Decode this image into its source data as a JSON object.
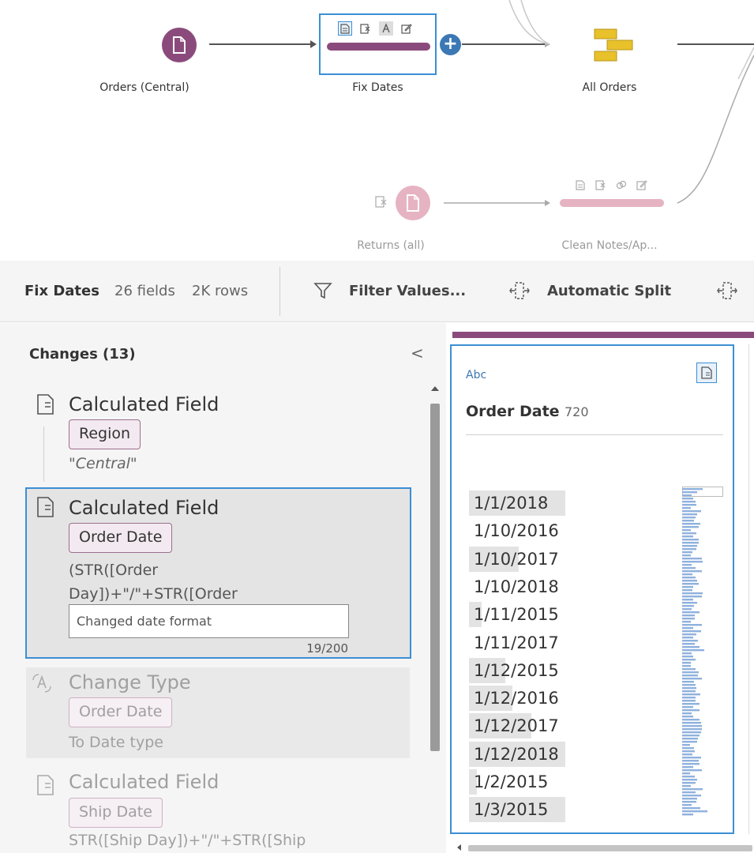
{
  "flow": {
    "nodes": [
      {
        "label": "Orders (Central)"
      },
      {
        "label": "Fix Dates"
      },
      {
        "label": "All Orders"
      },
      {
        "label": "Returns (all)"
      },
      {
        "label": "Clean Notes/Ap..."
      }
    ],
    "add_button": "+"
  },
  "toolbar": {
    "step_name": "Fix Dates",
    "fields": "26 fields",
    "rows": "2K rows",
    "filter_label": "Filter Values...",
    "split_label": "Automatic Split"
  },
  "changes": {
    "header": "Changes (13)",
    "collapse": "<",
    "items": [
      {
        "title": "Calculated Field",
        "field": "Region",
        "detail": "\"Central\""
      },
      {
        "title": "Calculated Field",
        "field": "Order Date",
        "formula_line1": "(STR([Order",
        "formula_line2": "Day])+\"/\"+STR([Order",
        "note_value": "Changed date format",
        "char_count": "19/200"
      },
      {
        "title": "Change Type",
        "field": "Order Date",
        "detail": "To Date type"
      },
      {
        "title": "Calculated Field",
        "field": "Ship Date",
        "formula_line1": "STR([Ship Day])+\"/\"+STR([Ship"
      }
    ]
  },
  "profile": {
    "type_label": "Abc",
    "field_name": "Order Date",
    "count": "720",
    "values": [
      "1/1/2018",
      "1/10/2016",
      "1/10/2017",
      "1/10/2018",
      "1/11/2015",
      "1/11/2017",
      "1/12/2015",
      "1/12/2016",
      "1/12/2017",
      "1/12/2018",
      "1/2/2015",
      "1/3/2015"
    ],
    "value_fill": [
      1.0,
      0.0,
      0.52,
      0.0,
      0.13,
      0.0,
      0.38,
      0.45,
      0.65,
      1.0,
      0.08,
      1.0
    ]
  },
  "colors": {
    "accent_blue": "#3b8fd4",
    "input_node": "#8a4b7c",
    "union_node": "#e8c12b",
    "faded_node": "#e6b3c2",
    "pill_border": "#9c6f8e",
    "histogram": "#8fb1dd"
  }
}
